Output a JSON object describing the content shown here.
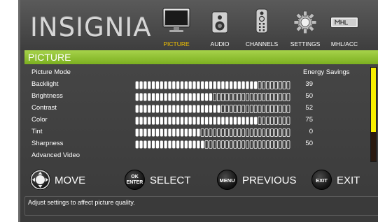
{
  "brand": {
    "logo_text": "INSIGNIA"
  },
  "tabs": [
    {
      "label": "PICTURE",
      "icon": "tv-icon",
      "active": true
    },
    {
      "label": "AUDIO",
      "icon": "speaker-icon",
      "active": false
    },
    {
      "label": "CHANNELS",
      "icon": "remote-icon",
      "active": false
    },
    {
      "label": "SETTINGS",
      "icon": "gear-icon",
      "active": false
    },
    {
      "label": "MHL/ACC",
      "icon": "mhl-icon",
      "active": false
    }
  ],
  "section": {
    "title": "PICTURE"
  },
  "settings": [
    {
      "name": "Picture Mode",
      "value": "Energy Savings",
      "level": null
    },
    {
      "name": "Backlight",
      "value": "39",
      "level": 0.78
    },
    {
      "name": "Brightness",
      "value": "50",
      "level": 0.5
    },
    {
      "name": "Contrast",
      "value": "52",
      "level": 0.54
    },
    {
      "name": "Color",
      "value": "75",
      "level": 0.78
    },
    {
      "name": "Tint",
      "value": "0",
      "level": 0.43
    },
    {
      "name": "Sharpness",
      "value": "50",
      "level": 0.45
    },
    {
      "name": "Advanced Video",
      "value": "",
      "level": null
    }
  ],
  "navigation": {
    "move": {
      "label": "MOVE",
      "key": ""
    },
    "select": {
      "label": "SELECT",
      "key_top": "OK",
      "key_bottom": "ENTER"
    },
    "previous": {
      "label": "PREVIOUS",
      "key": "MENU"
    },
    "exit": {
      "label": "EXIT",
      "key": "EXIT"
    }
  },
  "hint": "Adjust settings to affect picture quality.",
  "colors": {
    "accent_green": "#8dc03a",
    "active_tab": "#f2c200",
    "scroll_thumb": "#f8ee00",
    "background": "#3e3e3e"
  }
}
